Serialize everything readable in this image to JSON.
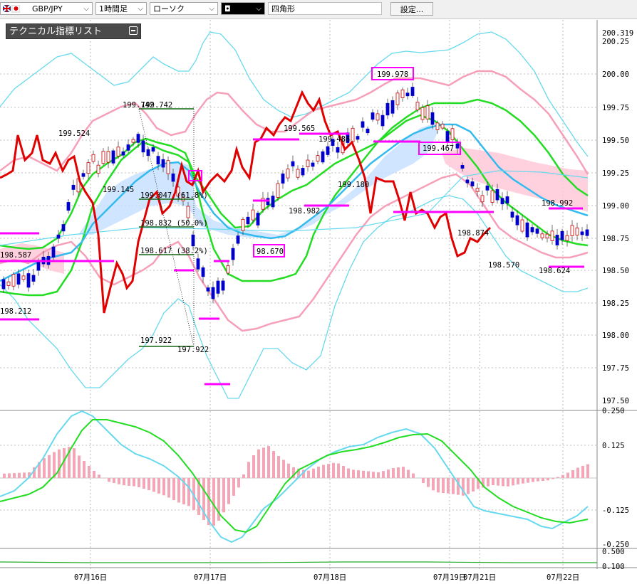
{
  "toolbar": {
    "symbol": "GBP/JPY",
    "timeframe": "1時間足",
    "chart_type": "ローソク",
    "color_swatch": "◘",
    "drawing_tool": "四角形",
    "settings_label": "設定..."
  },
  "panel": {
    "title": "テクニカル指標リスト"
  },
  "colors": {
    "candle_up": "#cc0000",
    "candle_down": "#0000cc",
    "bollinger_outer": "#66d9ee",
    "bollinger_inner": "#f5a0b8",
    "ma_short": "#22cc22",
    "ma_long": "#33bbee",
    "line_red": "#e00000",
    "marker": "#ff00ff",
    "cloud_pink": "#ffc8d8",
    "cloud_blue": "#c8e0ff",
    "macd_hist": "#f4a6b6"
  },
  "chart_data": [
    {
      "type": "line",
      "title": "",
      "yticks": [
        "200.319",
        "200.25",
        "200.00",
        "199.75",
        "199.50",
        "199.25",
        "199.00",
        "198.75",
        "198.50",
        "198.25",
        "198.00",
        "197.75",
        "197.50"
      ],
      "xticks": [
        "07月16日",
        "07月17日",
        "07月18日",
        "07月19日",
        "07月21日",
        "07月22日"
      ],
      "ylim": [
        197.5,
        200.319
      ],
      "annotations": [
        {
          "text": "199.742",
          "y": 199.742
        },
        {
          "text": "199.742",
          "y": 199.742
        },
        {
          "text": "199.524",
          "y": 199.524
        },
        {
          "text": "199.145",
          "y": 199.145
        },
        {
          "text": "199.047 (61.8%)",
          "y": 199.047
        },
        {
          "text": "198.832 (50.0%)",
          "y": 198.832
        },
        {
          "text": "198.617 (38.2%)",
          "y": 198.617
        },
        {
          "text": "197.922",
          "y": 197.922
        },
        {
          "text": "197.922",
          "y": 197.922
        },
        {
          "text": "198.587",
          "y": 198.587
        },
        {
          "text": "198.212",
          "y": 198.212
        },
        {
          "text": "199.565",
          "y": 199.565
        },
        {
          "text": "199.486",
          "y": 199.486
        },
        {
          "text": "199.180",
          "y": 199.18
        },
        {
          "text": "198.982",
          "y": 198.982
        },
        {
          "text": "98.670",
          "y": 198.67
        },
        {
          "text": "199.978",
          "y": 199.978
        },
        {
          "text": "199.467",
          "y": 199.467
        },
        {
          "text": "198.874",
          "y": 198.874
        },
        {
          "text": "198.570",
          "y": 198.57
        },
        {
          "text": "198.992",
          "y": 198.992
        },
        {
          "text": "198.624",
          "y": 198.624
        }
      ]
    },
    {
      "type": "bar",
      "title": "",
      "yticks": [
        "0.250",
        "0.125",
        "-0.125",
        "-0.250"
      ],
      "ylim": [
        -0.25,
        0.25
      ]
    },
    {
      "type": "line",
      "title": "",
      "yticks": [
        "0.500",
        "0.100"
      ]
    }
  ]
}
